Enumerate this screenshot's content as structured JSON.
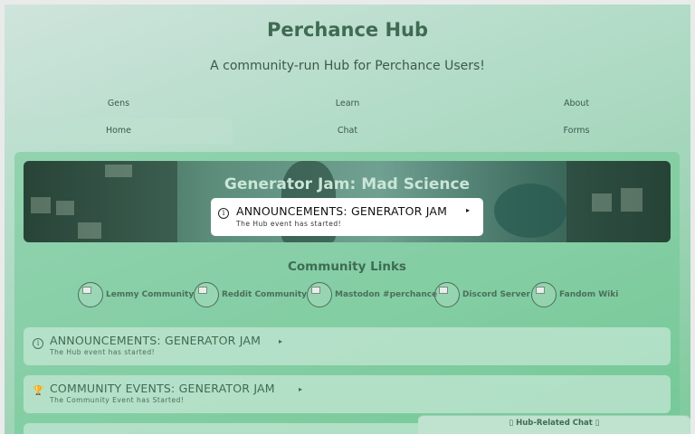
{
  "header": {
    "title": "Perchance Hub",
    "subtitle": "A community-run Hub for Perchance Users!"
  },
  "nav": {
    "row1": [
      "Gens",
      "Learn",
      "About"
    ],
    "row2": [
      "Home",
      "Chat",
      "Forms"
    ],
    "active": "Home"
  },
  "banner": {
    "title": "Generator Jam: Mad Science",
    "popup_title": "ANNOUNCEMENTS: GENERATOR JAM",
    "popup_arrow": "▸",
    "popup_subtitle": "The Hub event has started!",
    "popup_icon": "info-icon"
  },
  "community": {
    "heading": "Community Links",
    "links": [
      "Lemmy Community",
      "Reddit Community",
      "Mastodon #perchance",
      "Discord Server",
      "Fandom Wiki"
    ]
  },
  "cards": [
    {
      "icon": "info-icon",
      "icon_glyph": "i",
      "title": "ANNOUNCEMENTS: GENERATOR JAM",
      "arrow": "▸",
      "subtitle": "The Hub event has started!"
    },
    {
      "icon": "trophy-icon",
      "icon_glyph": "🏆",
      "title": "COMMUNITY EVENTS: GENERATOR JAM",
      "arrow": "▸",
      "subtitle": "The Community Event has Started!"
    }
  ],
  "chat": {
    "label": "▯ Hub-Related Chat ▯"
  },
  "colors": {
    "accent": "#3f6b52",
    "background_start": "#cfe4dc",
    "background_end": "#7ec99c"
  }
}
